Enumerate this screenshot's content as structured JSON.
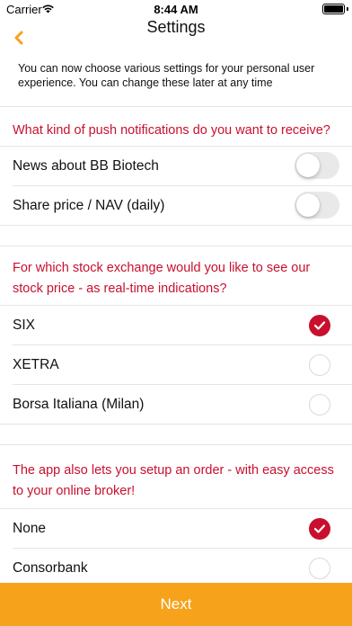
{
  "status_bar": {
    "carrier": "Carrier",
    "time": "8:44 AM",
    "wifi_icon": "wifi-icon",
    "battery_icon": "battery-icon"
  },
  "nav": {
    "title": "Settings",
    "back_icon": "chevron-left-icon"
  },
  "intro": "You can now choose various settings for your personal user experience. You can change these later at any time",
  "notifications": {
    "question": "What kind of push notifications do you want to receive?",
    "items": [
      {
        "label": "News about BB Biotech",
        "on": false
      },
      {
        "label": "Share price / NAV (daily)",
        "on": false
      }
    ]
  },
  "exchange": {
    "question": "For which stock exchange would you like to see our stock price - as real-time indications?",
    "options": [
      {
        "label": "SIX",
        "selected": true
      },
      {
        "label": "XETRA",
        "selected": false
      },
      {
        "label": "Borsa Italiana (Milan)",
        "selected": false
      }
    ]
  },
  "broker": {
    "question": "The app also lets you setup an order - with easy access to your online broker!",
    "options": [
      {
        "label": "None",
        "selected": true
      },
      {
        "label": "Consorbank",
        "selected": false
      }
    ]
  },
  "next_label": "Next",
  "colors": {
    "accent": "#f7a21b",
    "brand_red": "#c8102e",
    "divider": "#e4e4e4"
  }
}
